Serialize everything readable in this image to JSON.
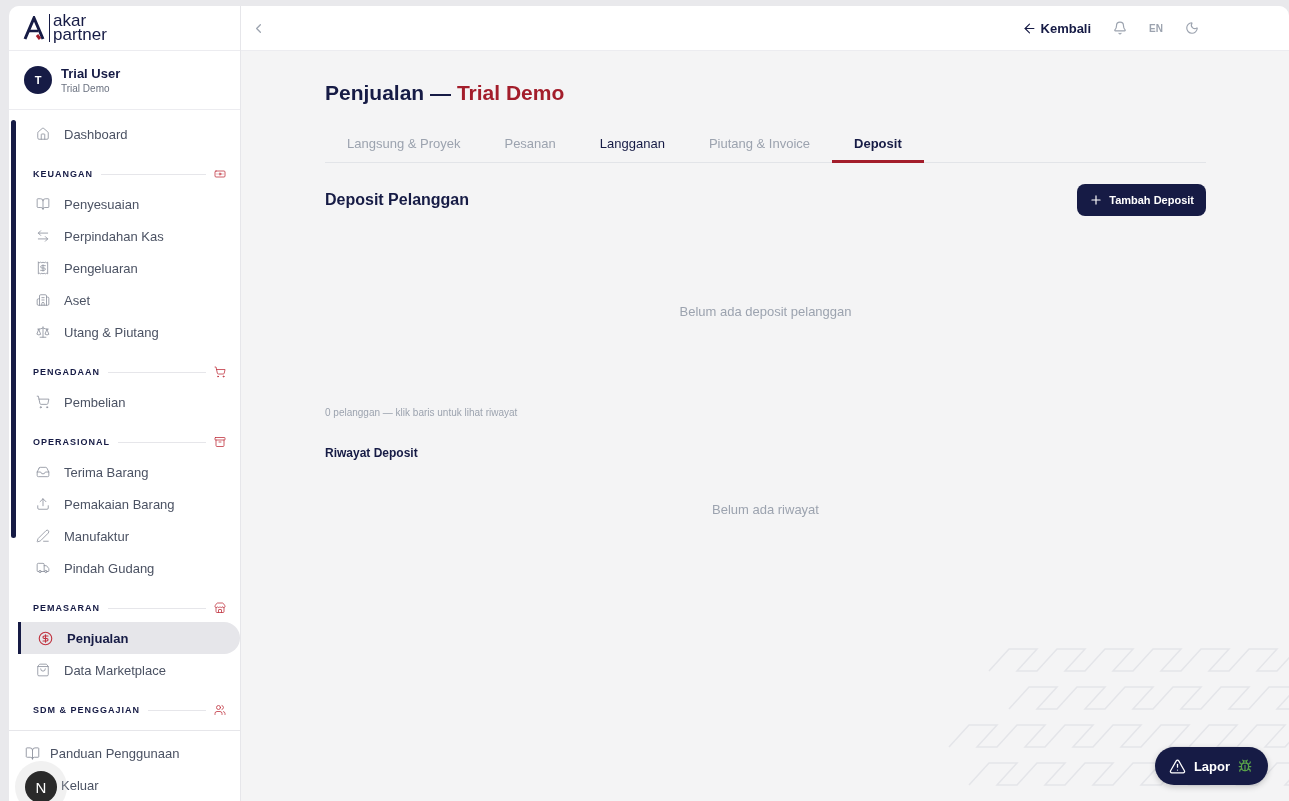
{
  "brand": {
    "line_1": "akar",
    "line_2": "partner"
  },
  "user": {
    "initial": "T",
    "name": "Trial User",
    "company": "Trial Demo"
  },
  "sidebar": {
    "sections": [
      {
        "kind": "plain",
        "items": [
          {
            "label": "Dashboard",
            "selected": false
          }
        ]
      },
      {
        "kind": "group",
        "title": "KEUANGAN",
        "items": [
          {
            "label": "Penyesuaian",
            "selected": false
          },
          {
            "label": "Perpindahan Kas",
            "selected": false
          },
          {
            "label": "Pengeluaran",
            "selected": false
          },
          {
            "label": "Aset",
            "selected": false
          },
          {
            "label": "Utang & Piutang",
            "selected": false
          }
        ]
      },
      {
        "kind": "group",
        "title": "PENGADAAN",
        "items": [
          {
            "label": "Pembelian",
            "selected": false
          }
        ]
      },
      {
        "kind": "group",
        "title": "OPERASIONAL",
        "items": [
          {
            "label": "Terima Barang",
            "selected": false
          },
          {
            "label": "Pemakaian Barang",
            "selected": false
          },
          {
            "label": "Manufaktur",
            "selected": false
          },
          {
            "label": "Pindah Gudang",
            "selected": false
          }
        ]
      },
      {
        "kind": "group",
        "title": "PEMASARAN",
        "items": [
          {
            "label": "Penjualan",
            "selected": true
          },
          {
            "label": "Data Marketplace",
            "selected": false
          }
        ]
      },
      {
        "kind": "group",
        "title": "SDM & PENGGAJIAN"
      }
    ],
    "footer": [
      {
        "label": "Panduan Penggunaan"
      },
      {
        "label": "Keluar"
      }
    ]
  },
  "header": {
    "back": "Kembali",
    "language": "EN"
  },
  "page": {
    "title": "Penjualan —",
    "title_accent": "Trial Demo",
    "tabs": [
      {
        "label": "Langsung & Proyek",
        "selected": false,
        "hovered": false
      },
      {
        "label": "Pesanan",
        "selected": false,
        "hovered": false
      },
      {
        "label": "Langganan",
        "selected": false,
        "hovered": true
      },
      {
        "label": "Piutang & Invoice",
        "selected": false,
        "hovered": false
      },
      {
        "label": "Deposit",
        "selected": true,
        "hovered": false
      }
    ],
    "section_title": "Deposit Pelanggan",
    "add_button": "Tambah Deposit",
    "empty_deposits": "Belum ada deposit pelanggan",
    "count_note": "0 pelanggan — klik baris untuk lihat riwayat",
    "history_title": "Riwayat Deposit",
    "empty_history": "Belum ada riwayat"
  },
  "report_button": "Lapor",
  "dev_badge": "N"
}
